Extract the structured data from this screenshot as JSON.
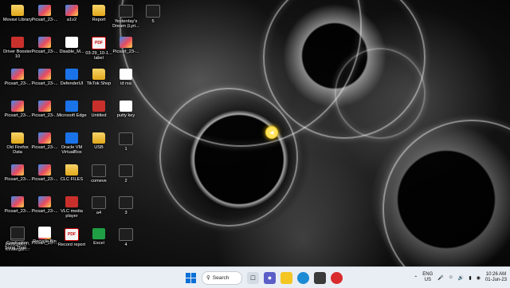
{
  "desktop": {
    "icons": [
      {
        "label": "Movavi Library",
        "kind": "folder"
      },
      {
        "label": "Picsart_23-...",
        "kind": "img"
      },
      {
        "label": "a1v2",
        "kind": "img"
      },
      {
        "label": "Report",
        "kind": "folder"
      },
      {
        "label": "Yesterday's Dream (Lyri...",
        "kind": "dark"
      },
      {
        "label": "5",
        "kind": "dark"
      },
      {
        "label": "Driver Booster 10",
        "kind": "app-red"
      },
      {
        "label": "Picsart_23-...",
        "kind": "img"
      },
      {
        "label": "Disable_M...",
        "kind": "doc"
      },
      {
        "label": "03-29_10-1... label",
        "kind": "pdf"
      },
      {
        "label": "Picsart_23-...",
        "kind": "img"
      },
      {
        "label": "Picsart_23-...",
        "kind": "img"
      },
      {
        "label": "Picsart_23-...",
        "kind": "img"
      },
      {
        "label": "DefenderUI",
        "kind": "app-blue"
      },
      {
        "label": "TikTok Shop",
        "kind": "folder"
      },
      {
        "label": "id rsa",
        "kind": "doc"
      },
      {
        "label": "Picsart_23-...",
        "kind": "img"
      },
      {
        "label": "Picsart_23-...",
        "kind": "img"
      },
      {
        "label": "Microsoft Edge",
        "kind": "app-blue"
      },
      {
        "label": "Untitled",
        "kind": "app-red"
      },
      {
        "label": "putty key",
        "kind": "doc"
      },
      {
        "label": "Old Firefox Data",
        "kind": "folder"
      },
      {
        "label": "Picsart_23-...",
        "kind": "img"
      },
      {
        "label": "Oracle VM VirtualBox",
        "kind": "app-blue"
      },
      {
        "label": "USB",
        "kind": "folder"
      },
      {
        "label": "1",
        "kind": "dark"
      },
      {
        "label": "Picsart_23-...",
        "kind": "img"
      },
      {
        "label": "Picsart_23-...",
        "kind": "img"
      },
      {
        "label": "CLC FILES",
        "kind": "folder"
      },
      {
        "label": "comeve",
        "kind": "dark"
      },
      {
        "label": "2",
        "kind": "dark"
      },
      {
        "label": "Picsart_23-...",
        "kind": "img"
      },
      {
        "label": "Picsart_23-...",
        "kind": "img"
      },
      {
        "label": "VLC media player",
        "kind": "app-red"
      },
      {
        "label": "a4",
        "kind": "dark"
      },
      {
        "label": "3",
        "kind": "dark"
      },
      {
        "label": "PANGAKO - Kindergart...",
        "kind": "dark"
      },
      {
        "label": "Picsart_23-...",
        "kind": "img"
      },
      {
        "label": "Record report",
        "kind": "pdf"
      },
      {
        "label": "Excel",
        "kind": "app-green"
      },
      {
        "label": "4",
        "kind": "dark"
      },
      {
        "label": "Graduation Song Than...",
        "kind": "dark"
      },
      {
        "label": "Recycle Bin",
        "kind": "doc"
      }
    ]
  },
  "taskbar": {
    "search_label": "Search",
    "tray": {
      "language": "ENG",
      "region": "US",
      "time": "10:26 AM",
      "date": "01-Jun-23"
    }
  }
}
